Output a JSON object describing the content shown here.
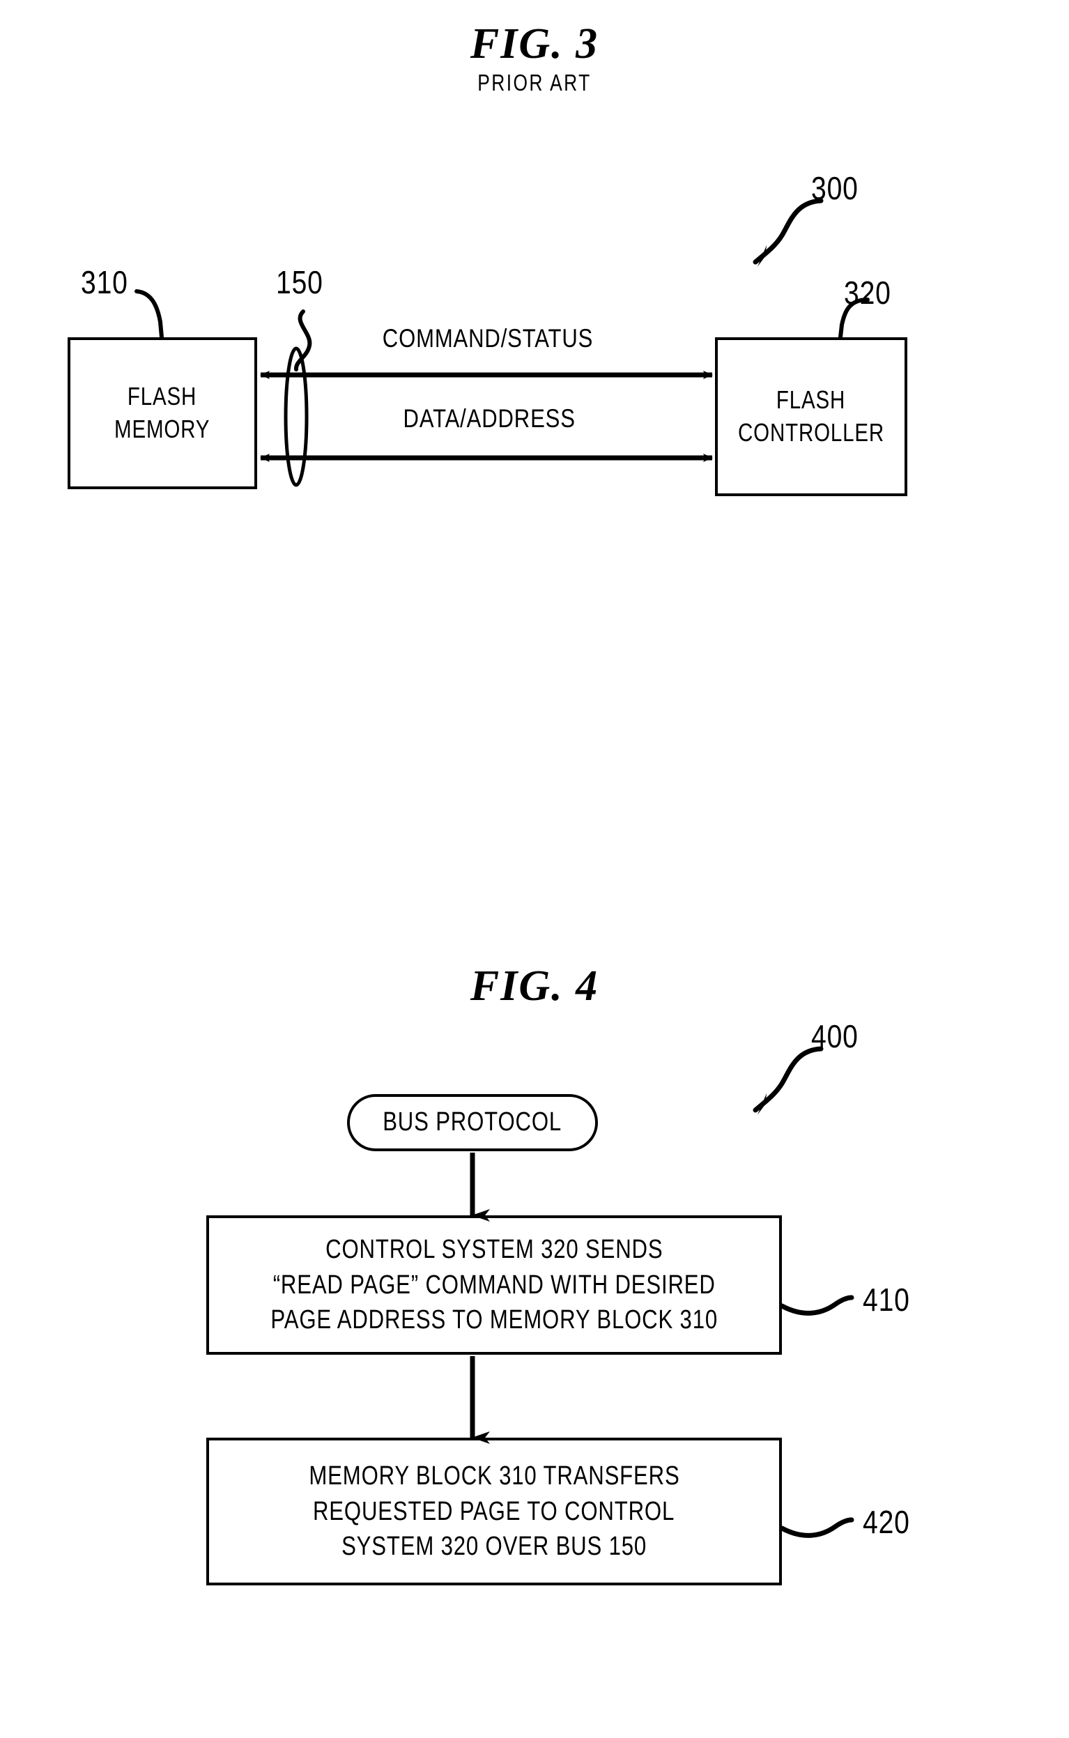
{
  "figures": [
    {
      "id": "fig3",
      "title": "FIG.  3",
      "subtitle": "PRIOR ART",
      "reference": "300",
      "nodes": {
        "flash_memory": {
          "label_line1": "FLASH",
          "label_line2": "MEMORY",
          "reference": "310"
        },
        "flash_controller": {
          "label_line1": "FLASH",
          "label_line2": "CONTROLLER",
          "reference": "320"
        }
      },
      "bus": {
        "reference": "150",
        "signals": [
          {
            "label": "COMMAND/STATUS",
            "direction": "bidirectional"
          },
          {
            "label": "DATA/ADDRESS",
            "direction": "bidirectional"
          }
        ]
      }
    },
    {
      "id": "fig4",
      "title": "FIG.  4",
      "reference": "400",
      "flow": {
        "start": {
          "label": "BUS  PROTOCOL",
          "shape": "stadium"
        },
        "steps": [
          {
            "reference": "410",
            "lines": [
              "CONTROL SYSTEM 320 SENDS",
              "“READ PAGE” COMMAND WITH DESIRED",
              "PAGE ADDRESS TO MEMORY BLOCK 310"
            ]
          },
          {
            "reference": "420",
            "lines": [
              "MEMORY BLOCK 310 TRANSFERS",
              "REQUESTED PAGE TO CONTROL",
              "SYSTEM 320 OVER BUS 150"
            ]
          }
        ]
      }
    }
  ],
  "colors": {
    "ink": "#000000",
    "paper": "#ffffff"
  }
}
